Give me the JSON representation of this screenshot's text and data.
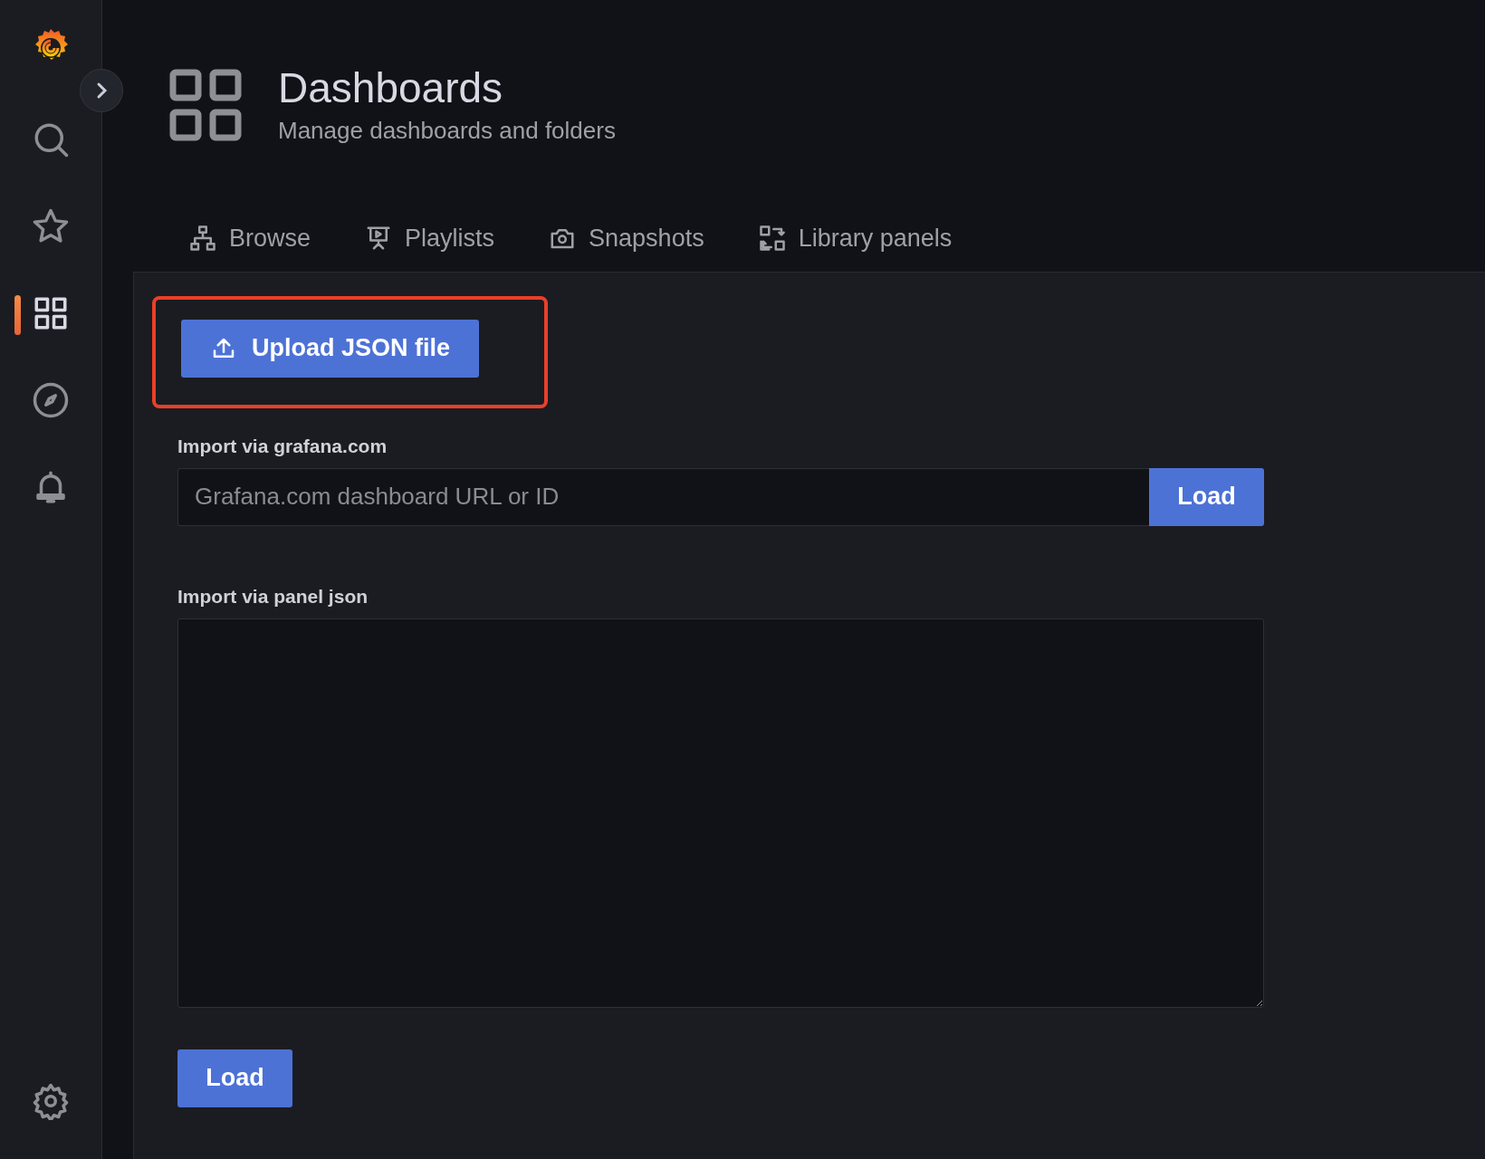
{
  "sidebar": {
    "items": [
      {
        "kind": "search",
        "selected": false
      },
      {
        "kind": "starred",
        "selected": false
      },
      {
        "kind": "dashboards",
        "selected": true
      },
      {
        "kind": "explore",
        "selected": false
      },
      {
        "kind": "alerting",
        "selected": false
      }
    ],
    "bottom_items": [
      {
        "kind": "settings",
        "selected": false
      }
    ]
  },
  "header": {
    "title": "Dashboards",
    "subtitle": "Manage dashboards and folders"
  },
  "tabs": [
    {
      "label": "Browse",
      "kind": "browse"
    },
    {
      "label": "Playlists",
      "kind": "playlists"
    },
    {
      "label": "Snapshots",
      "kind": "snapshots"
    },
    {
      "label": "Library panels",
      "kind": "library"
    }
  ],
  "upload": {
    "label": "Upload JSON file",
    "highlighted": true
  },
  "grafana_import": {
    "label": "Import via grafana.com",
    "placeholder": "Grafana.com dashboard URL or ID",
    "button": "Load"
  },
  "panel_import": {
    "label": "Import via panel json",
    "button": "Load"
  }
}
